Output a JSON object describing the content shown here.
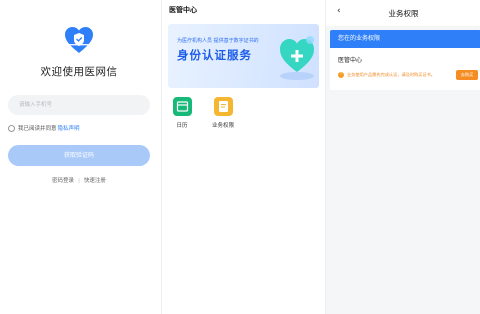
{
  "login": {
    "app_title": "欢迎使用医网信",
    "phone_placeholder": "请输入手机号",
    "agreement_text": "我已阅读并同意",
    "privacy_link": "隐私声明",
    "get_code_button": "获取验证码",
    "password_login": "密码登录",
    "separator": "|",
    "quick_register": "快速注册",
    "brand_color": "#2f80f8"
  },
  "center": {
    "title": "医管中心",
    "banner": {
      "subtitle": "为医疗机构人员 提供基于数字证书的",
      "headline": "身份认证服务"
    },
    "tiles": [
      {
        "label": "日历",
        "icon": "calendar-icon",
        "color": "#17b978"
      },
      {
        "label": "业务权限",
        "icon": "permission-icon",
        "color": "#f5b731"
      }
    ]
  },
  "permissions": {
    "back_icon": "chevron-left-icon",
    "title": "业务权限",
    "section_header": "您在的业务权限",
    "org_name": "医管中心",
    "notice": "业务使用产品需先完成认证，请及时购买证书。",
    "action_button": "去购买",
    "warning_color": "#f58d23"
  }
}
